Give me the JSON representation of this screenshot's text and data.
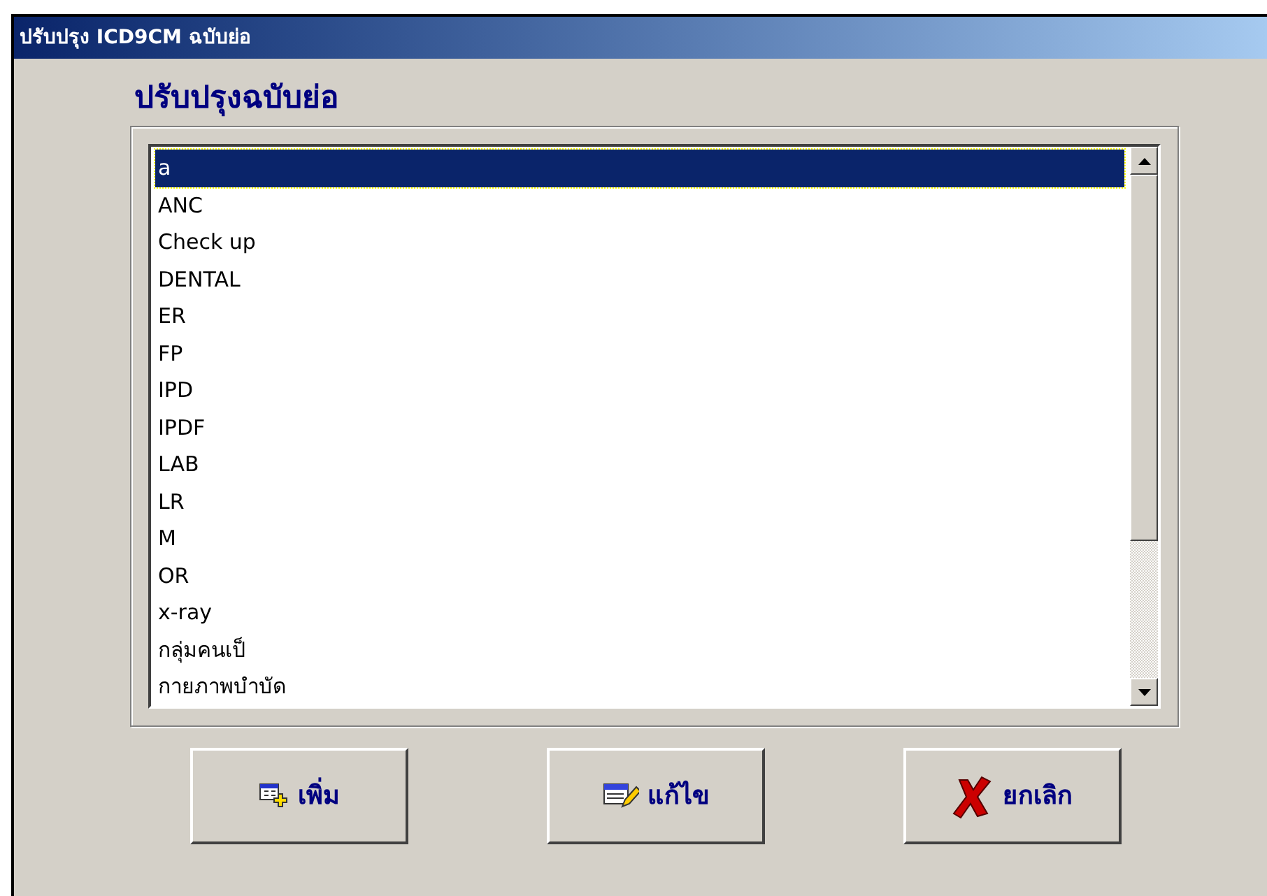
{
  "window": {
    "title": "ปรับปรุง ICD9CM ฉบับย่อ"
  },
  "heading": "ปรับปรุงฉบับย่อ",
  "items": [
    {
      "label": "a",
      "selected": true
    },
    {
      "label": "ANC",
      "selected": false
    },
    {
      "label": "Check up",
      "selected": false
    },
    {
      "label": "DENTAL",
      "selected": false
    },
    {
      "label": "ER",
      "selected": false
    },
    {
      "label": "FP",
      "selected": false
    },
    {
      "label": "IPD",
      "selected": false
    },
    {
      "label": "IPDF",
      "selected": false
    },
    {
      "label": "LAB",
      "selected": false
    },
    {
      "label": "LR",
      "selected": false
    },
    {
      "label": "M",
      "selected": false
    },
    {
      "label": "OR",
      "selected": false
    },
    {
      "label": "x-ray",
      "selected": false
    },
    {
      "label": "กลุ่มคนเป็",
      "selected": false
    },
    {
      "label": "กายภาพบำบัด",
      "selected": false
    }
  ],
  "buttons": [
    {
      "label": "เพิ่ม",
      "kind": "add"
    },
    {
      "label": "แก้ไข",
      "kind": "edit"
    },
    {
      "label": "ยกเลิก",
      "kind": "cancel"
    }
  ]
}
